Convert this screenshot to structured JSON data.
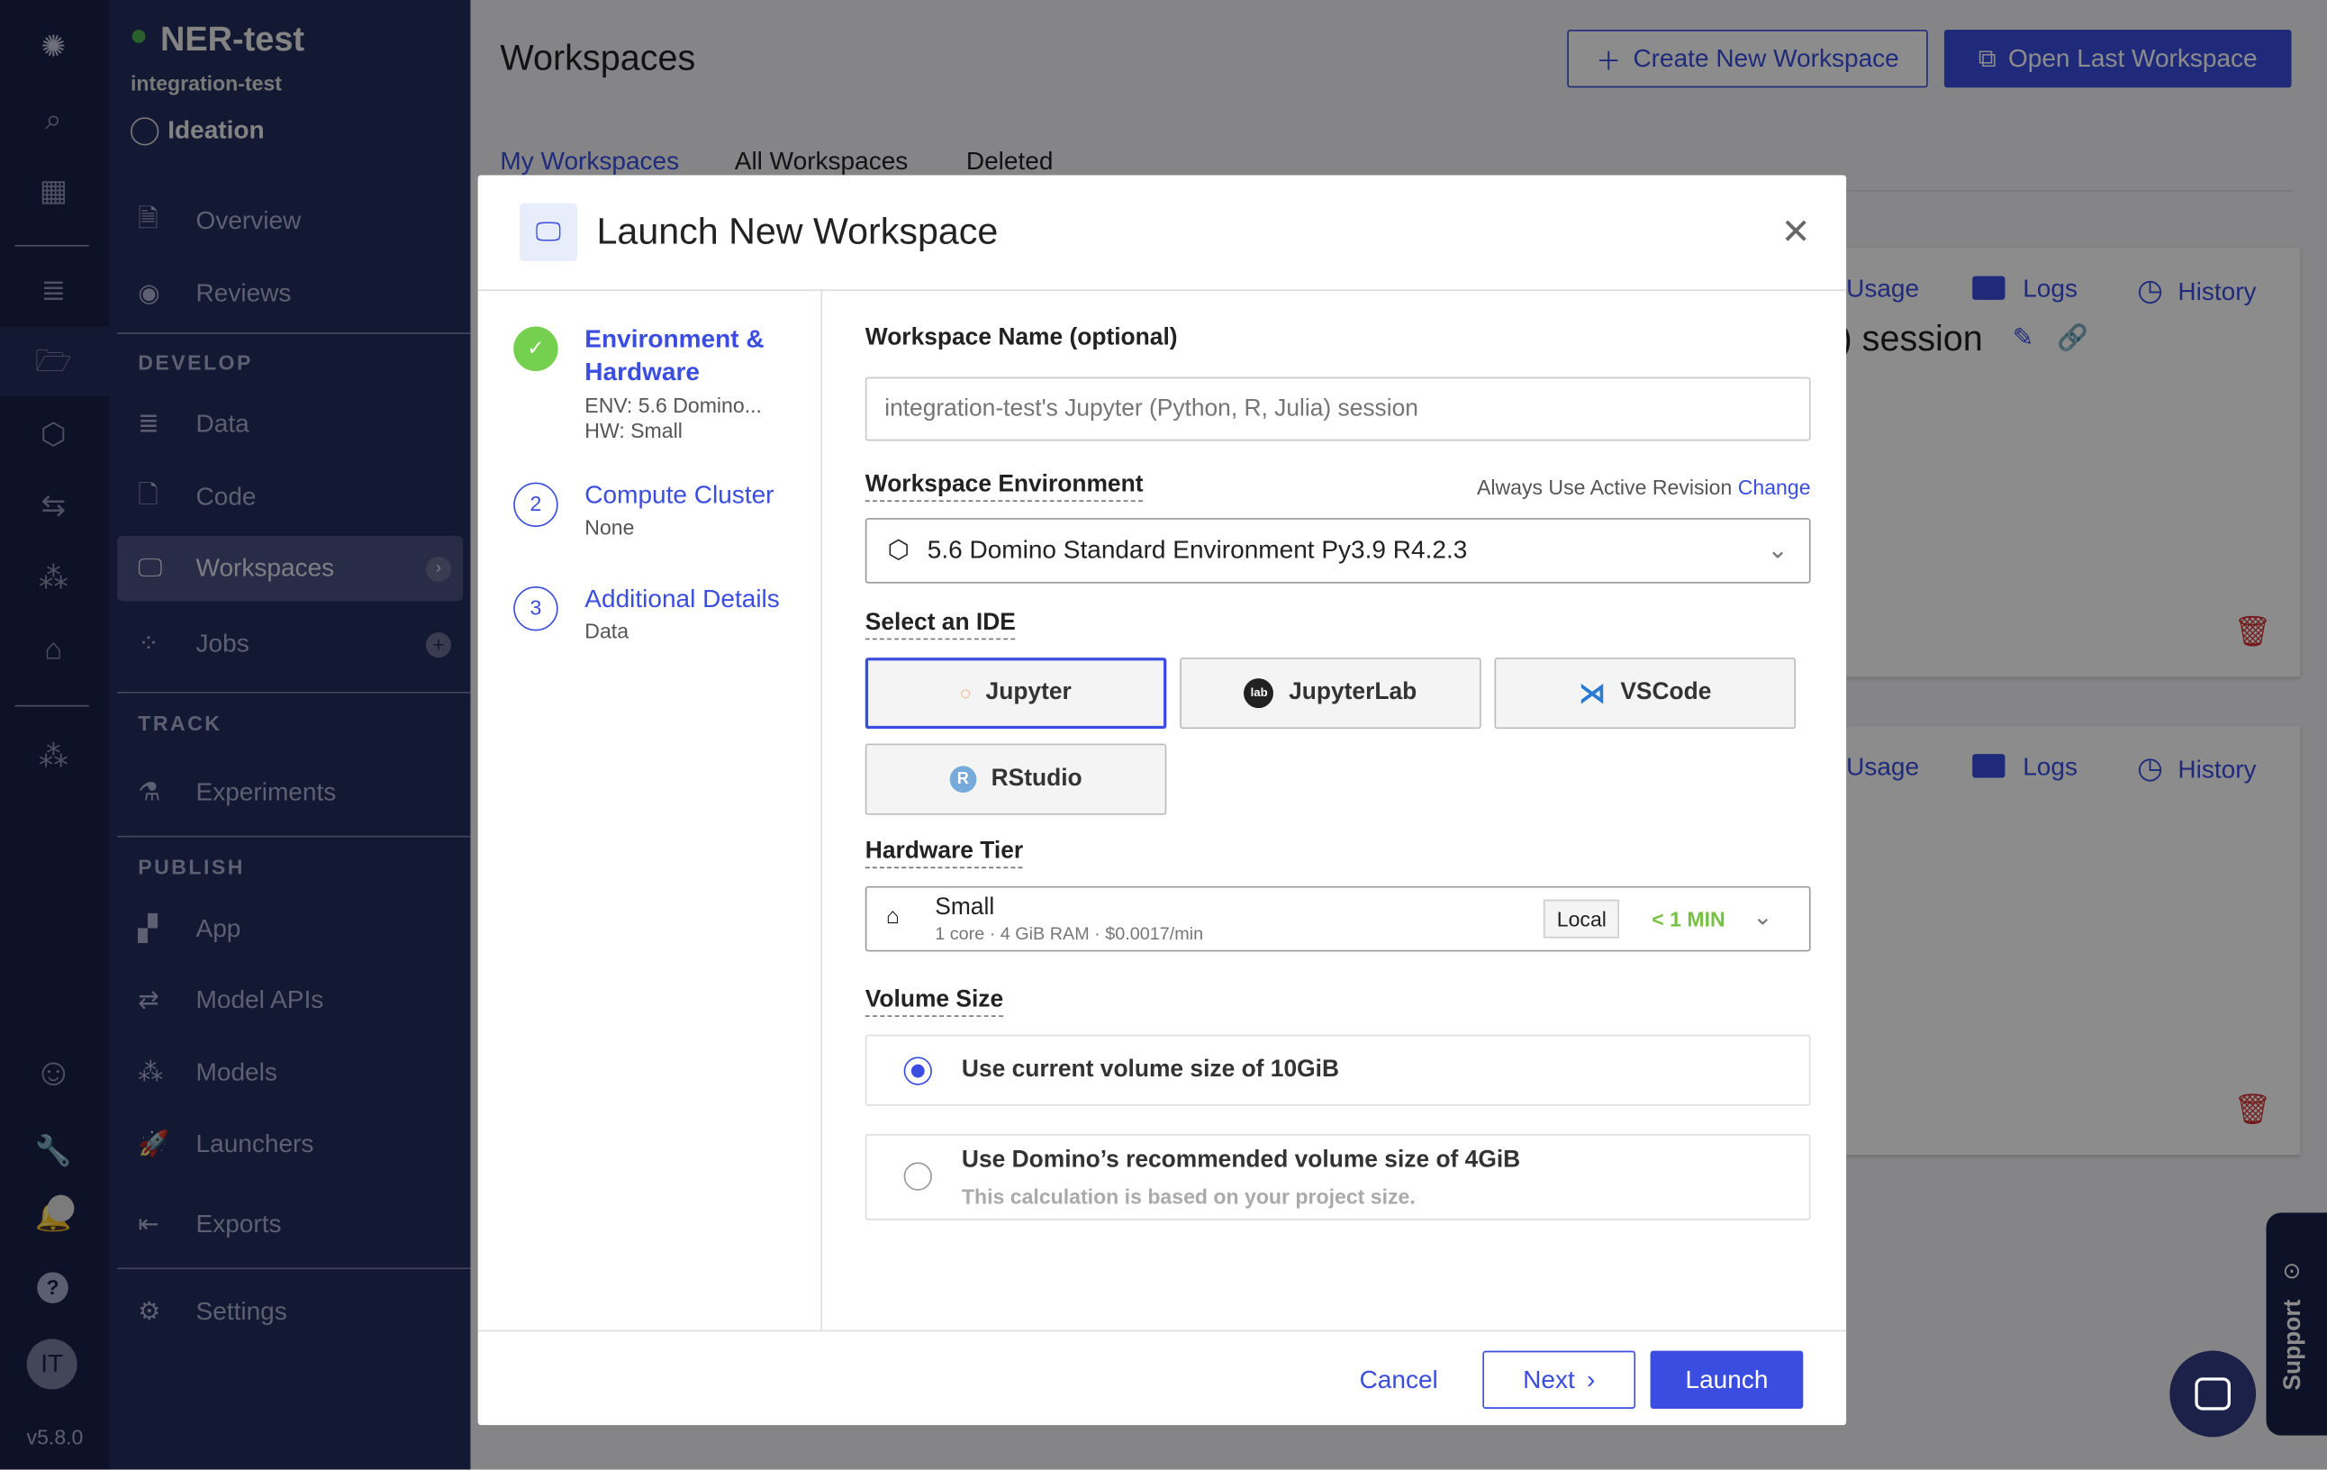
{
  "project": {
    "name": "NER-test",
    "owner": "integration-test",
    "stage": "Ideation",
    "status_color": "#4caf50"
  },
  "nav": {
    "items_top": [
      {
        "label": "Overview"
      },
      {
        "label": "Reviews"
      }
    ],
    "develop_header": "DEVELOP",
    "develop": [
      {
        "label": "Data"
      },
      {
        "label": "Code"
      },
      {
        "label": "Workspaces"
      },
      {
        "label": "Jobs"
      }
    ],
    "track_header": "TRACK",
    "track": [
      {
        "label": "Experiments"
      }
    ],
    "publish_header": "PUBLISH",
    "publish": [
      {
        "label": "App"
      },
      {
        "label": "Model APIs"
      },
      {
        "label": "Models"
      },
      {
        "label": "Launchers"
      },
      {
        "label": "Exports"
      }
    ],
    "settings": "Settings"
  },
  "rail": {
    "avatar": "IT",
    "version": "v5.8.0"
  },
  "page": {
    "title": "Workspaces",
    "create_button": "Create New Workspace",
    "open_last_button": "Open Last Workspace",
    "tabs": [
      "My Workspaces",
      "All Workspaces",
      "Deleted"
    ],
    "cards": [
      {
        "usage": "Usage",
        "logs": "Logs",
        "history": "History",
        "title_fragment": ") session"
      },
      {
        "usage": "Usage",
        "logs": "Logs",
        "history": "History"
      }
    ],
    "support": "Support"
  },
  "modal": {
    "title": "Launch New Workspace",
    "steps": [
      {
        "num": "",
        "title": "Environment & Hardware",
        "sub1": "ENV: 5.6 Domino...",
        "sub2": "HW: Small",
        "state": "complete"
      },
      {
        "num": "2",
        "title": "Compute Cluster",
        "sub1": "None"
      },
      {
        "num": "3",
        "title": "Additional Details",
        "sub1": "Data"
      }
    ],
    "name_label": "Workspace Name (optional)",
    "name_placeholder": "integration-test's Jupyter (Python, R, Julia) session",
    "env_label": "Workspace Environment",
    "env_revision": "Always Use Active Revision",
    "env_change": "Change",
    "env_value": "5.6 Domino Standard Environment Py3.9 R4.2.3",
    "ide_label": "Select an IDE",
    "ides": [
      {
        "label": "Jupyter",
        "selected": true
      },
      {
        "label": "JupyterLab"
      },
      {
        "label": "VSCode"
      },
      {
        "label": "RStudio"
      }
    ],
    "hw_label": "Hardware Tier",
    "hw_name": "Small",
    "hw_detail": "1 core · 4 GiB RAM · $0.0017/min",
    "hw_badge": "Local",
    "hw_time": "< 1 MIN",
    "vol_label": "Volume Size",
    "vol_options": [
      {
        "label": "Use current volume size of 10GiB",
        "selected": true
      },
      {
        "label": "Use Domino’s recommended volume size of 4GiB",
        "note": "This calculation is based on your project size."
      }
    ],
    "cancel": "Cancel",
    "next": "Next",
    "launch": "Launch",
    "accent": "#3a4de0"
  }
}
